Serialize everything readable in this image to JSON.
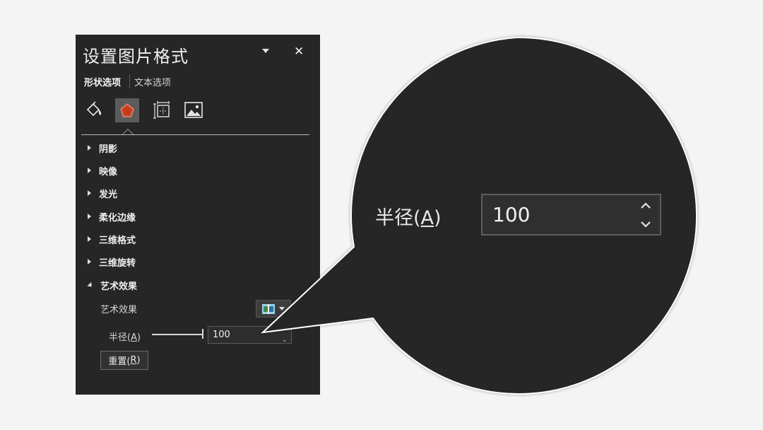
{
  "pane": {
    "title": "设置图片格式",
    "tabs": [
      {
        "label": "形状选项",
        "active": true
      },
      {
        "label": "文本选项",
        "active": false
      }
    ],
    "icons": [
      "fill-line-icon",
      "effects-icon",
      "size-properties-icon",
      "picture-icon"
    ],
    "sections": [
      {
        "label": "阴影",
        "expanded": false
      },
      {
        "label": "映像",
        "expanded": false
      },
      {
        "label": "发光",
        "expanded": false
      },
      {
        "label": "柔化边缘",
        "expanded": false
      },
      {
        "label": "三维格式",
        "expanded": false
      },
      {
        "label": "三维旋转",
        "expanded": false
      },
      {
        "label": "艺术效果",
        "expanded": true
      }
    ],
    "artistic": {
      "effect_label": "艺术效果",
      "radius_label": "半径(",
      "radius_accel": "A",
      "radius_close": ")",
      "radius_value": "100",
      "reset_label": "重置(",
      "reset_accel": "R",
      "reset_close": ")"
    }
  },
  "zoom": {
    "label": "半径(",
    "label_accel": "A",
    "label_close": ")",
    "value": "100"
  },
  "colors": {
    "pane_bg": "#262626",
    "accent": "#d24726",
    "page_bg": "#f4f4f5"
  }
}
